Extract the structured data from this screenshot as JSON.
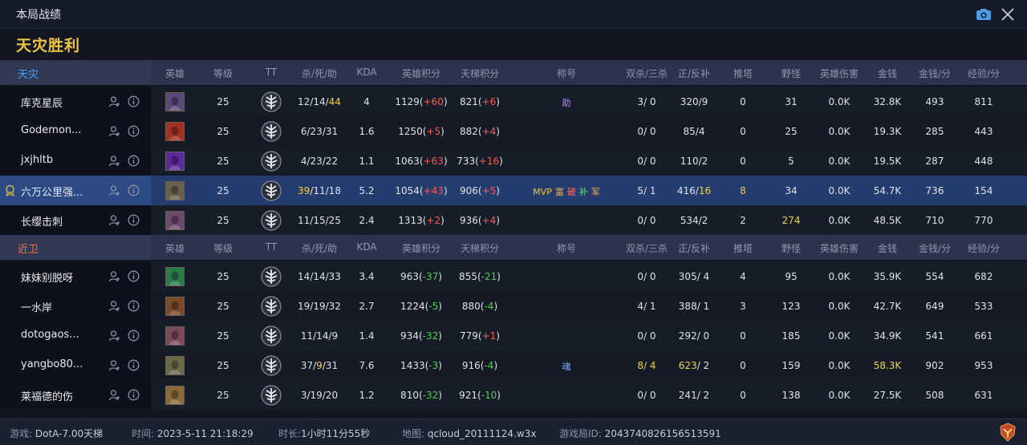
{
  "window": {
    "title": "本局战绩"
  },
  "result_text": "天灾胜利",
  "columns": {
    "hero": "英雄",
    "level": "等级",
    "tt": "TT",
    "kda_raw": "杀/死/助",
    "kda": "KDA",
    "hero_score": "英雄积分",
    "tt_score": "天梯积分",
    "title": "称号",
    "multi": "双杀/三杀",
    "cs": "正/反补",
    "towers": "推塔",
    "jungle": "野怪",
    "hero_damage": "英雄伤害",
    "gold": "金钱",
    "gpm": "金钱/分",
    "xpm": "经验/分"
  },
  "teams": [
    {
      "name": "天灾",
      "color": "#4aa3ff",
      "players": [
        {
          "name": "库克星辰",
          "hero_color": "#5a4a7a",
          "level": "25",
          "kda": [
            {
              "t": "12/14/"
            },
            {
              "t": "44",
              "c": "y"
            }
          ],
          "kda_val": "4",
          "hs": [
            {
              "t": "1129("
            },
            {
              "t": "+60",
              "c": "r"
            },
            {
              "t": ")"
            }
          ],
          "ts": [
            {
              "t": "821("
            },
            {
              "t": "+6",
              "c": "r"
            },
            {
              "t": ")"
            }
          ],
          "titles": [
            {
              "t": "助",
              "c": "purple"
            }
          ],
          "multi": [
            {
              "t": "3/ 0"
            }
          ],
          "cs": [
            {
              "t": "320/9"
            }
          ],
          "towers": [
            {
              "t": "0"
            }
          ],
          "jungle": [
            {
              "t": "31"
            }
          ],
          "dmg": "0.0K",
          "gold": [
            {
              "t": "32.8K"
            }
          ],
          "gpm": "493",
          "xpm": "811"
        },
        {
          "name": "Godemon...",
          "hero_color": "#a03020",
          "level": "25",
          "kda": [
            {
              "t": "6/23/31"
            }
          ],
          "kda_val": "1.6",
          "hs": [
            {
              "t": "1250("
            },
            {
              "t": "+5",
              "c": "r"
            },
            {
              "t": ")"
            }
          ],
          "ts": [
            {
              "t": "882("
            },
            {
              "t": "+4",
              "c": "r"
            },
            {
              "t": ")"
            }
          ],
          "titles": [],
          "multi": [
            {
              "t": "0/ 0"
            }
          ],
          "cs": [
            {
              "t": "85/4"
            }
          ],
          "towers": [
            {
              "t": "0"
            }
          ],
          "jungle": [
            {
              "t": "25"
            }
          ],
          "dmg": "0.0K",
          "gold": [
            {
              "t": "19.3K"
            }
          ],
          "gpm": "285",
          "xpm": "443"
        },
        {
          "name": "jxjhltb",
          "hero_color": "#5a2a9a",
          "level": "25",
          "kda": [
            {
              "t": "4/23/22"
            }
          ],
          "kda_val": "1.1",
          "hs": [
            {
              "t": "1063("
            },
            {
              "t": "+63",
              "c": "r"
            },
            {
              "t": ")"
            }
          ],
          "ts": [
            {
              "t": "733("
            },
            {
              "t": "+16",
              "c": "r"
            },
            {
              "t": ")"
            }
          ],
          "titles": [],
          "multi": [
            {
              "t": "0/ 0"
            }
          ],
          "cs": [
            {
              "t": "110/2"
            }
          ],
          "towers": [
            {
              "t": "0"
            }
          ],
          "jungle": [
            {
              "t": "5"
            }
          ],
          "dmg": "0.0K",
          "gold": [
            {
              "t": "19.5K"
            }
          ],
          "gpm": "287",
          "xpm": "448"
        },
        {
          "name": "六万公里强...",
          "hero_color": "#6a6050",
          "level": "25",
          "highlight": true,
          "kda": [
            {
              "t": "39",
              "c": "y"
            },
            {
              "t": "/11/18"
            }
          ],
          "kda_val": "5.2",
          "hs": [
            {
              "t": "1054("
            },
            {
              "t": "+43",
              "c": "r"
            },
            {
              "t": ")"
            }
          ],
          "ts": [
            {
              "t": "906("
            },
            {
              "t": "+5",
              "c": "r"
            },
            {
              "t": ")"
            }
          ],
          "titles": [
            {
              "t": "MVP",
              "c": "mvp"
            },
            {
              "t": "富",
              "c": "gold"
            },
            {
              "t": "破",
              "c": "red"
            },
            {
              "t": "补",
              "c": "green"
            },
            {
              "t": "军",
              "c": "gold"
            }
          ],
          "multi": [
            {
              "t": "5/ 1"
            }
          ],
          "cs": [
            {
              "t": "416/"
            },
            {
              "t": "16",
              "c": "y"
            }
          ],
          "towers": [
            {
              "t": "8",
              "c": "y"
            }
          ],
          "jungle": [
            {
              "t": "34"
            }
          ],
          "dmg": "0.0K",
          "gold": [
            {
              "t": "54.7K"
            }
          ],
          "gpm": "736",
          "xpm": "154"
        },
        {
          "name": "长缨击刺",
          "hero_color": "#6a4a6a",
          "level": "25",
          "kda": [
            {
              "t": "11/15/25"
            }
          ],
          "kda_val": "2.4",
          "hs": [
            {
              "t": "1313("
            },
            {
              "t": "+2",
              "c": "r"
            },
            {
              "t": ")"
            }
          ],
          "ts": [
            {
              "t": "936("
            },
            {
              "t": "+4",
              "c": "r"
            },
            {
              "t": ")"
            }
          ],
          "titles": [],
          "multi": [
            {
              "t": "0/ 0"
            }
          ],
          "cs": [
            {
              "t": "534/2"
            }
          ],
          "towers": [
            {
              "t": "2"
            }
          ],
          "jungle": [
            {
              "t": "274",
              "c": "y"
            }
          ],
          "dmg": "0.0K",
          "gold": [
            {
              "t": "48.5K"
            }
          ],
          "gpm": "710",
          "xpm": "770"
        }
      ]
    },
    {
      "name": "近卫",
      "color": "#ff6a3c",
      "players": [
        {
          "name": "妹妹别脱呀",
          "hero_color": "#2a7a4a",
          "level": "25",
          "kda": [
            {
              "t": "14/14/33"
            }
          ],
          "kda_val": "3.4",
          "hs": [
            {
              "t": "963("
            },
            {
              "t": "-37",
              "c": "g"
            },
            {
              "t": ")"
            }
          ],
          "ts": [
            {
              "t": "855("
            },
            {
              "t": "-21",
              "c": "g"
            },
            {
              "t": ")"
            }
          ],
          "titles": [],
          "multi": [
            {
              "t": "0/ 0"
            }
          ],
          "cs": [
            {
              "t": "305/ 4"
            }
          ],
          "towers": [
            {
              "t": "4"
            }
          ],
          "jungle": [
            {
              "t": "95"
            }
          ],
          "dmg": "0.0K",
          "gold": [
            {
              "t": "35.9K"
            }
          ],
          "gpm": "554",
          "xpm": "682"
        },
        {
          "name": "一水岸",
          "hero_color": "#7a4a2a",
          "level": "25",
          "kda": [
            {
              "t": "19/19/32"
            }
          ],
          "kda_val": "2.7",
          "hs": [
            {
              "t": "1224("
            },
            {
              "t": "-5",
              "c": "g"
            },
            {
              "t": ")"
            }
          ],
          "ts": [
            {
              "t": "880("
            },
            {
              "t": "-4",
              "c": "g"
            },
            {
              "t": ")"
            }
          ],
          "titles": [],
          "multi": [
            {
              "t": "4/ 1"
            }
          ],
          "cs": [
            {
              "t": "388/ 1"
            }
          ],
          "towers": [
            {
              "t": "3"
            }
          ],
          "jungle": [
            {
              "t": "123"
            }
          ],
          "dmg": "0.0K",
          "gold": [
            {
              "t": "42.7K"
            }
          ],
          "gpm": "649",
          "xpm": "533"
        },
        {
          "name": "dotogaos...",
          "hero_color": "#7a4a5a",
          "level": "25",
          "kda": [
            {
              "t": "11/14/9"
            }
          ],
          "kda_val": "1.4",
          "hs": [
            {
              "t": "934("
            },
            {
              "t": "-32",
              "c": "g"
            },
            {
              "t": ")"
            }
          ],
          "ts": [
            {
              "t": "779("
            },
            {
              "t": "+1",
              "c": "r"
            },
            {
              "t": ")"
            }
          ],
          "titles": [],
          "multi": [
            {
              "t": "0/ 0"
            }
          ],
          "cs": [
            {
              "t": "292/ 0"
            }
          ],
          "towers": [
            {
              "t": "0"
            }
          ],
          "jungle": [
            {
              "t": "185"
            }
          ],
          "dmg": "0.0K",
          "gold": [
            {
              "t": "34.9K"
            }
          ],
          "gpm": "541",
          "xpm": "661"
        },
        {
          "name": "yangbo80...",
          "hero_color": "#6a6a4a",
          "level": "25",
          "kda": [
            {
              "t": "37/"
            },
            {
              "t": "9",
              "c": "y"
            },
            {
              "t": "/31"
            }
          ],
          "kda_val": "7.6",
          "hs": [
            {
              "t": "1433("
            },
            {
              "t": "-3",
              "c": "g"
            },
            {
              "t": ")"
            }
          ],
          "ts": [
            {
              "t": "916("
            },
            {
              "t": "-4",
              "c": "g"
            },
            {
              "t": ")"
            }
          ],
          "titles": [
            {
              "t": "魂",
              "c": "soul"
            }
          ],
          "multi": [
            {
              "t": "8/ 4",
              "c": "y"
            }
          ],
          "cs": [
            {
              "t": "623",
              "c": "y"
            },
            {
              "t": "/ 2"
            }
          ],
          "towers": [
            {
              "t": "0"
            }
          ],
          "jungle": [
            {
              "t": "159"
            }
          ],
          "dmg": "0.0K",
          "gold": [
            {
              "t": "58.3K",
              "c": "y"
            }
          ],
          "gpm": "902",
          "xpm": "953"
        },
        {
          "name": "莱福德的伤",
          "hero_color": "#8a6a3a",
          "level": "25",
          "kda": [
            {
              "t": "3/19/20"
            }
          ],
          "kda_val": "1.2",
          "hs": [
            {
              "t": "810("
            },
            {
              "t": "-32",
              "c": "g"
            },
            {
              "t": ")"
            }
          ],
          "ts": [
            {
              "t": "921("
            },
            {
              "t": "-10",
              "c": "g"
            },
            {
              "t": ")"
            }
          ],
          "titles": [],
          "multi": [
            {
              "t": "0/ 0"
            }
          ],
          "cs": [
            {
              "t": "241/ 2"
            }
          ],
          "towers": [
            {
              "t": "0"
            }
          ],
          "jungle": [
            {
              "t": "138"
            }
          ],
          "dmg": "0.0K",
          "gold": [
            {
              "t": "27.5K"
            }
          ],
          "gpm": "508",
          "xpm": "631"
        }
      ]
    }
  ],
  "footer": {
    "game_label": "游戏:",
    "game_value": "DotA-7.00天梯",
    "time_label": "时间:",
    "time_value": "2023-5-11 21:18:29",
    "duration_label": "时长:",
    "duration_value": "1小时11分55秒",
    "map_label": "地图:",
    "map_value": "qcloud_20111124.w3x",
    "gameid_label": "游戏局ID:",
    "gameid_value": "2043740826156513591"
  }
}
